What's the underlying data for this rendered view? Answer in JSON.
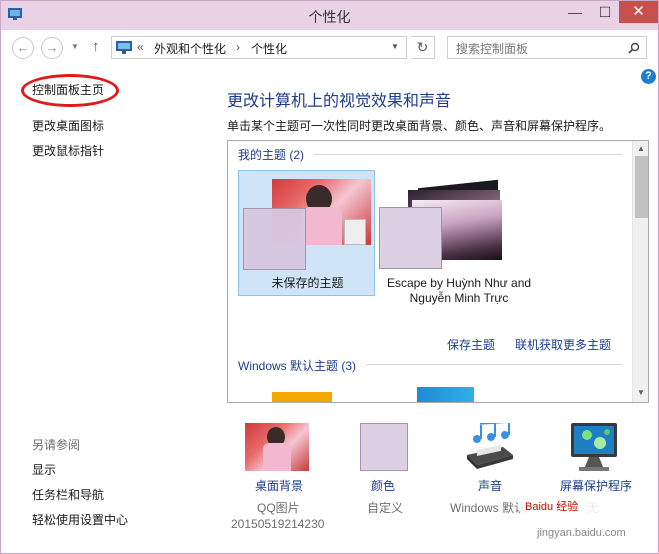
{
  "window": {
    "title": "个性化",
    "buttons": {
      "minimize": "—",
      "maximize": "☐",
      "close": "✕"
    }
  },
  "nav": {
    "back": "←",
    "forward": "→",
    "up": "↑",
    "breadcrumb": [
      "外观和个性化",
      "个性化"
    ],
    "breadcrumb_prefix": "«",
    "separator": "›",
    "search_placeholder": "搜索控制面板",
    "refresh": "↻"
  },
  "help": "?",
  "sidebar": {
    "items": [
      {
        "label": "控制面板主页"
      },
      {
        "label": "更改桌面图标"
      },
      {
        "label": "更改鼠标指针"
      }
    ],
    "see_also_title": "另请参阅",
    "see_also": [
      {
        "label": "显示"
      },
      {
        "label": "任务栏和导航"
      },
      {
        "label": "轻松使用设置中心"
      }
    ]
  },
  "main": {
    "heading": "更改计算机上的视觉效果和声音",
    "subheading": "单击某个主题可一次性同时更改桌面背景、颜色、声音和屏幕保护程序。",
    "groups": [
      {
        "title": "我的主题 (2)",
        "themes": [
          {
            "label": "未保存的主题"
          },
          {
            "label": "Escape by Huỳnh Như and Nguyễn Minh Trực"
          }
        ],
        "actions": [
          "保存主题",
          "联机获取更多主题"
        ]
      },
      {
        "title": "Windows 默认主题 (3)"
      }
    ]
  },
  "bottom": {
    "items": [
      {
        "link": "桌面背景",
        "sub1": "QQ图片",
        "sub2": "20150519214230"
      },
      {
        "link": "颜色",
        "sub1": "自定义"
      },
      {
        "link": "声音",
        "sub1": "Windows 默认"
      },
      {
        "link": "屏幕保护程序",
        "sub1": "无"
      }
    ]
  },
  "watermark": {
    "text": "Baidu 经验",
    "url": "jingyan.baidu.com"
  },
  "colors": {
    "accent": "#1e3d8f",
    "title_bg": "#e9d1e6",
    "close": "#c7504f",
    "selection": "#cfe5f7"
  }
}
